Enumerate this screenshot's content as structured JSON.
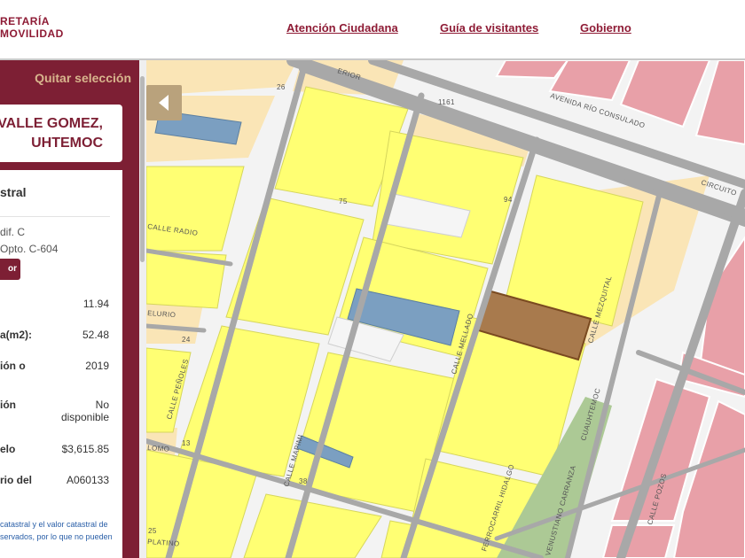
{
  "header": {
    "brand_line1": "RETARÍA",
    "brand_line2": "MOVILIDAD",
    "nav": [
      "Atención Ciudadana",
      "Guía de visitantes",
      "Gobierno"
    ]
  },
  "panel": {
    "clear_selection": "Quitar selección",
    "address_line1": "VALLE GOMEZ,",
    "address_line2": "UHTEMOC",
    "section_title": "stral",
    "unit_line1": "dif. C",
    "unit_line2": "Opto. C-604",
    "chip_label": "or",
    "fields": [
      {
        "label": "",
        "value": "11.94"
      },
      {
        "label": "a(m2):",
        "value": "52.48"
      },
      {
        "label": "ión o",
        "value": "2019"
      },
      {
        "label": "ión",
        "value": "No disponible"
      },
      {
        "label": "elo",
        "value": "$3,615.85"
      },
      {
        "label": "rio del",
        "value": "A060133"
      }
    ],
    "note_line1": "catastral y el valor catastral de",
    "note_line2": "servados, por lo que no pueden"
  },
  "map": {
    "streets": [
      "ERIOR",
      "AVENIDA RÍO CONSULADO",
      "CIRCUITO",
      "CALLE RADIO",
      "ELURIO",
      "CALLE PEÑOLES",
      "CALLE MAPIMI",
      "CALLE MELLADO",
      "CALLE MEZQUITAL",
      "CUAUHTEMOC",
      "VENUSTIANO CARRANZA",
      "CALLE POZOS",
      "FERROCARRIL HIDALGO",
      "LOMO",
      "PLATINO"
    ],
    "numbers": [
      "1161",
      "26",
      "75",
      "24",
      "13",
      "25",
      "94",
      "38"
    ],
    "colors": {
      "lot": "#ffff73",
      "street": "#a8a8a8",
      "selected": "#a87a4d",
      "blue": "#7b9fc1",
      "pink": "#e8a0a8",
      "tan": "#fae5b6",
      "green": "#acc995"
    }
  }
}
